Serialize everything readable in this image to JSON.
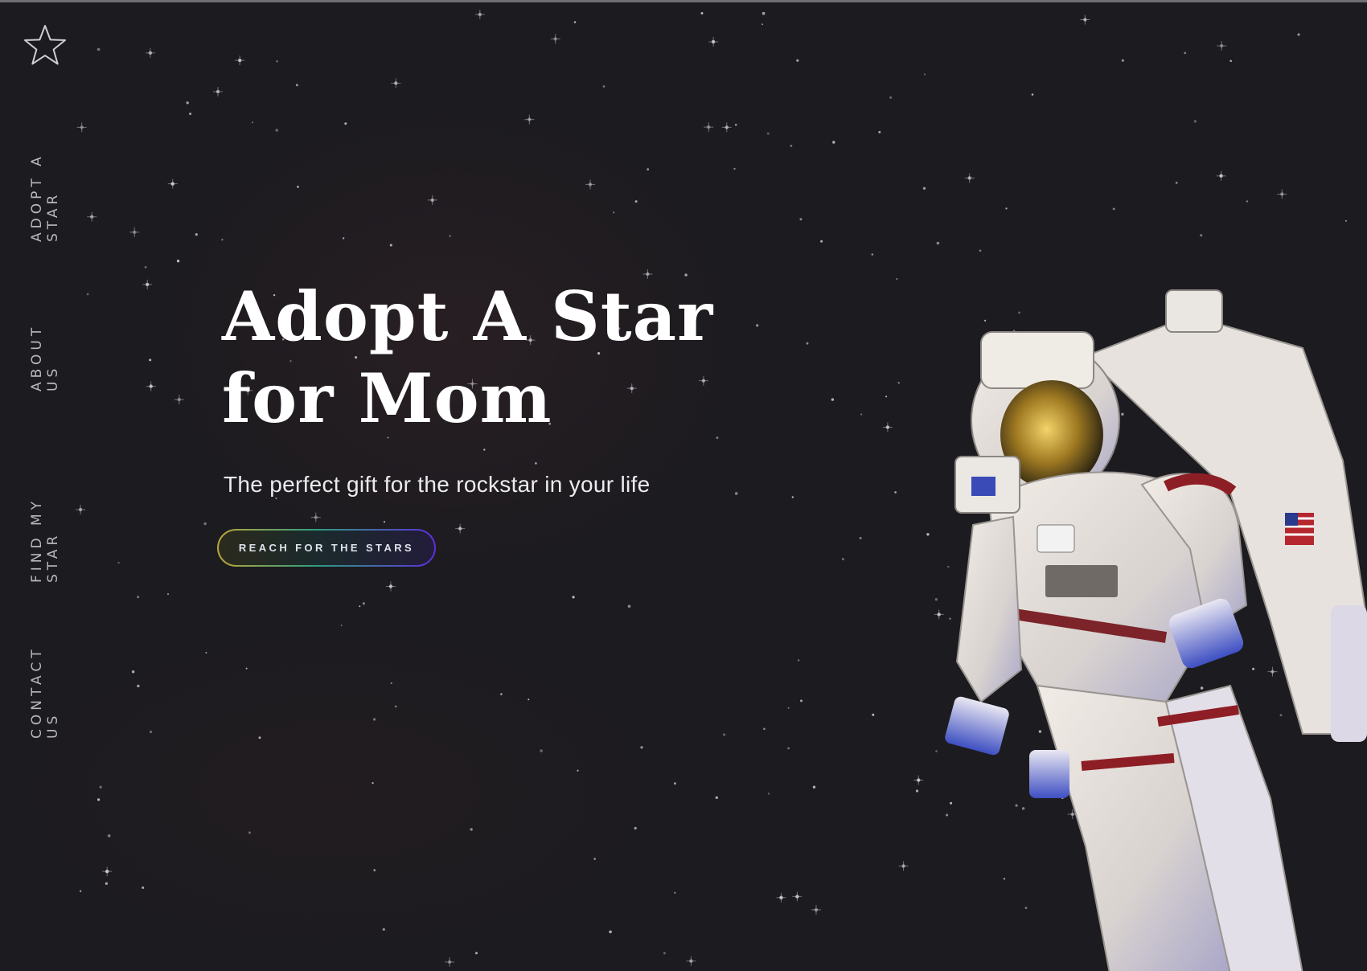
{
  "brand": {
    "logo_icon": "star-outline-icon"
  },
  "nav": {
    "items": [
      {
        "label": "ADOPT A STAR"
      },
      {
        "label": "ABOUT US"
      },
      {
        "label": "FIND MY STAR"
      },
      {
        "label": "CONTACT US"
      }
    ]
  },
  "hero": {
    "title_line1": "Adopt A Star",
    "title_line2": "for Mom",
    "subtitle": "The perfect gift for the rockstar in your life",
    "cta_label": "REACH FOR THE STARS"
  },
  "image": {
    "subject": "astronaut-illustration"
  },
  "colors": {
    "background": "#1c1b1f",
    "text": "#ffffff",
    "nav_text": "#b8b8bd",
    "cta_gradient_start": "#b9a53a",
    "cta_gradient_mid": "#2f9c7e",
    "cta_gradient_end": "#5b2fd8"
  }
}
